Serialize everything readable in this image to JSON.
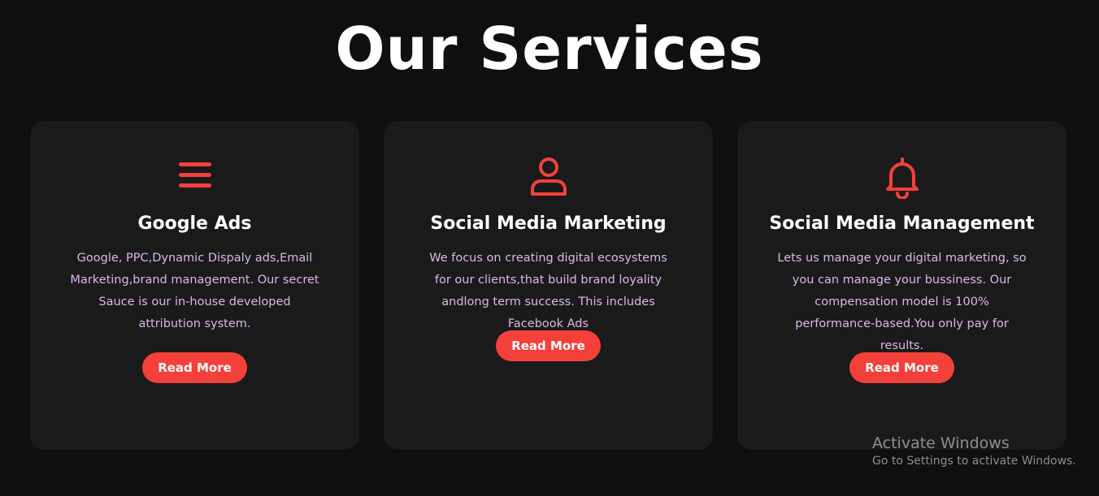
{
  "page": {
    "title": "Our Services",
    "background": "#100f10"
  },
  "theme": {
    "accent": "#f4403a",
    "card_bg": "#1b1a1b",
    "text": "#ffffff",
    "desc_text": "#d9b8e6"
  },
  "services": [
    {
      "icon": "menu-icon",
      "title": "Google Ads",
      "description": "Google, PPC,Dynamic Dispaly ads,Email Marketing,brand management. Our secret Sauce is our in-house developed attribution system.",
      "button_label": "Read More"
    },
    {
      "icon": "user-icon",
      "title": "Social Media Marketing",
      "description": "We focus on creating digital ecosystems for our clients,that build brand loyality andlong term success. This includes Facebook Ads",
      "button_label": "Read More"
    },
    {
      "icon": "bell-icon",
      "title": "Social Media Management",
      "description": "Lets us manage your digital marketing, so you can manage your bussiness. Our compensation model is 100% performance-based.You only pay for results.",
      "button_label": "Read More"
    }
  ],
  "windows_activation": {
    "title": "Activate Windows",
    "subtitle": "Go to Settings to activate Windows."
  }
}
